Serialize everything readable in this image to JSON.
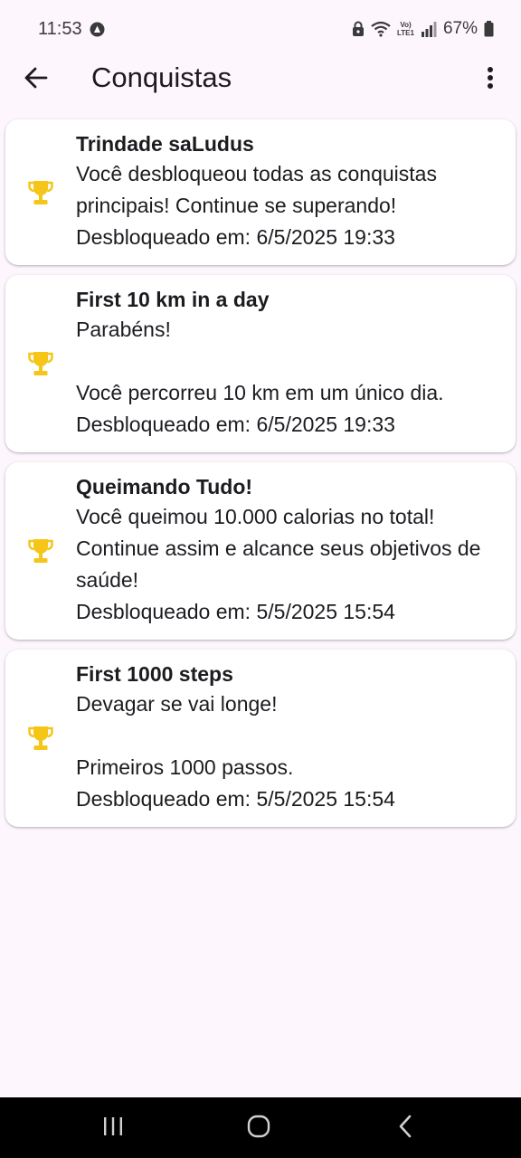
{
  "status_bar": {
    "time": "11:53",
    "battery": "67%",
    "network_label": "LTE1",
    "volte_label": "Vo)"
  },
  "app_bar": {
    "title": "Conquistas",
    "back_icon": "arrow-back-icon",
    "menu_icon": "more-vert-icon"
  },
  "colors": {
    "background": "#fdf7fd",
    "card": "#ffffff",
    "trophy": "#f5c518",
    "text": "#1d1b20"
  },
  "achievements": [
    {
      "title": "Trindade saLudus",
      "description": "Você desbloqueou todas as conquistas principais! Continue se superando!",
      "date": "Desbloqueado em: 6/5/2025 19:33"
    },
    {
      "title": "First 10 km in a day",
      "description": "Parabéns!\n\nVocê percorreu 10 km em um único dia.",
      "date": "Desbloqueado em: 6/5/2025 19:33"
    },
    {
      "title": "Queimando Tudo!",
      "description": "Você queimou 10.000 calorias no total! Continue assim e alcance seus objetivos de saúde!",
      "date": "Desbloqueado em: 5/5/2025 15:54"
    },
    {
      "title": "First 1000 steps",
      "description": "Devagar se vai longe!\n\nPrimeiros 1000 passos.",
      "date": "Desbloqueado em: 5/5/2025 15:54"
    }
  ],
  "nav_bar": {
    "recents_icon": "recents-icon",
    "home_icon": "home-icon",
    "back_icon": "nav-back-icon"
  }
}
